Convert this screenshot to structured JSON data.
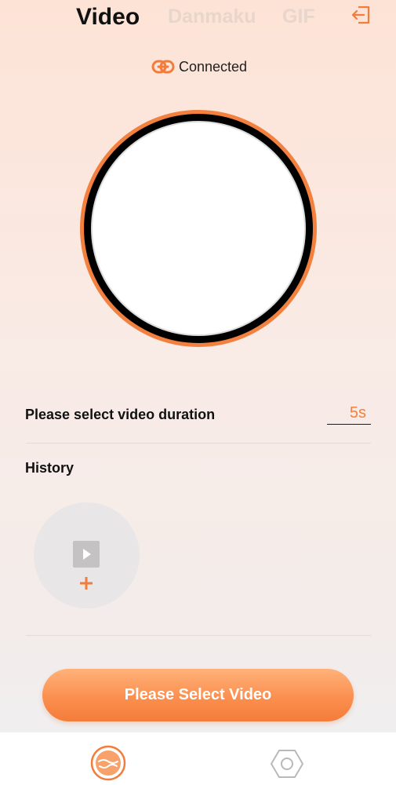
{
  "header": {
    "tabs": [
      {
        "label": "Video",
        "active": true
      },
      {
        "label": "Danmaku",
        "active": false
      },
      {
        "label": "GIF",
        "active": false
      }
    ],
    "exit_icon": "exit-icon"
  },
  "connection": {
    "status_text": "Connected",
    "icon": "link-icon"
  },
  "duration": {
    "label": "Please select video duration",
    "value": "5s"
  },
  "history": {
    "label": "History",
    "add_tile_icons": [
      "play-icon",
      "plus-icon"
    ]
  },
  "actions": {
    "select_video_label": "Please Select Video"
  },
  "bottom_nav": {
    "items": [
      {
        "icon": "home-device-icon",
        "active": true
      },
      {
        "icon": "settings-hexagon-icon",
        "active": false
      }
    ]
  },
  "colors": {
    "accent": "#f47c3a",
    "accent_light": "#ffb27a",
    "ring_outer": "#f2803f",
    "ring_inner": "#000000",
    "inactive_tab": "#e8d5cc"
  }
}
